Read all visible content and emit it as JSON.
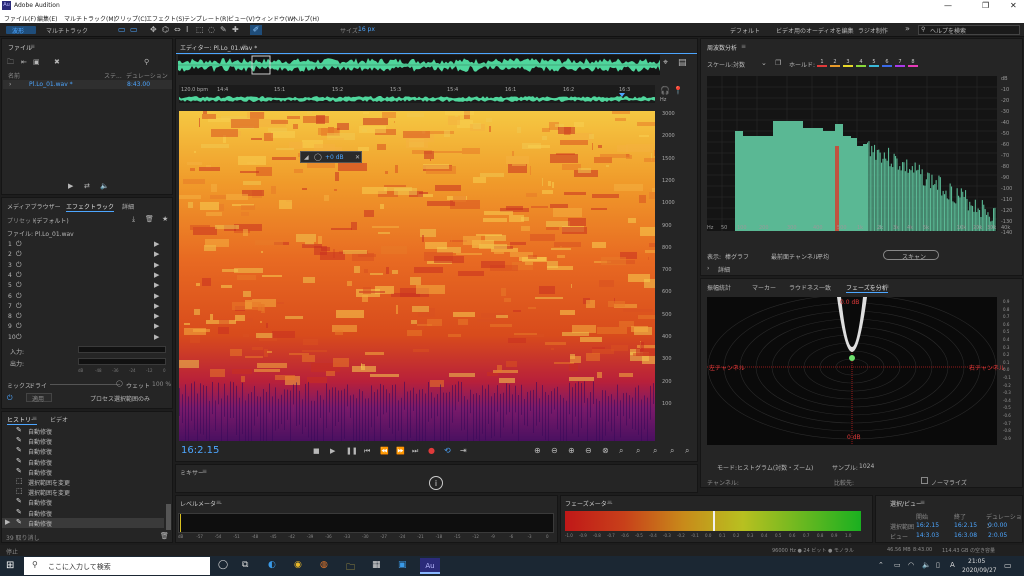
{
  "window": {
    "title": "Adobe Audition",
    "app_icon": "Au",
    "controls": [
      "—",
      "❐",
      "✕"
    ]
  },
  "menu": [
    "ファイル(F)",
    "編集(E)",
    "マルチトラック(M)",
    "クリップ(C)",
    "エフェクト(S)",
    "テンプレート(R)",
    "ビュー(V)",
    "ウィンドウ(W)",
    "ヘルプ(H)"
  ],
  "toolbar": {
    "mode_waveform": "波形",
    "mode_multitrack": "マルチトラック",
    "size_label": "サイズ:",
    "size_value": "16 px",
    "workspaces": [
      "デフォルト",
      "ビデオ用のオーディオを編集",
      "ラジオ制作"
    ],
    "help_search": "ヘルプを検索"
  },
  "files_panel": {
    "title": "ファイル",
    "col_name": "名前",
    "col_status": "ステ...",
    "col_duration": "デュレーション",
    "file_name": "Pl.Lo_01.wav *",
    "file_duration": "8:43.00"
  },
  "effects_panel": {
    "tabs": [
      "メディアブラウザー",
      "エフェクトラック",
      "詳細"
    ],
    "preset_label": "プリセット:",
    "preset_value": "(デフォルト)",
    "file_label": "ファイル: Pl.Lo_01.wav",
    "slots": [
      "1",
      "2",
      "3",
      "4",
      "5",
      "6",
      "7",
      "8",
      "9",
      "10"
    ],
    "input_label": "入力:",
    "output_label": "出力:",
    "db_scale": [
      "dB",
      "-48",
      "-36",
      "-24",
      "-12",
      "0"
    ],
    "mix_label": "ミックス:",
    "mix_dry": "ドライ",
    "mix_wet": "ウェット",
    "mix_value": "100 %",
    "apply_button": "適用",
    "process_label": "プロセス:",
    "process_value": "選択範囲のみ"
  },
  "history_panel": {
    "tabs": [
      "ヒストリー",
      "ビデオ"
    ],
    "items": [
      "自動修復",
      "自動修復",
      "自動修復",
      "自動修復",
      "自動修復",
      "選択範囲を変更",
      "選択範囲を変更",
      "自動修復",
      "自動修復",
      "自動修復"
    ],
    "undo_count": "39 取り消し"
  },
  "editor": {
    "title": "エディター: Pl.Lo_01.wav *",
    "timeline": [
      "120.0 bpm",
      "14:4",
      "15:1",
      "15:2",
      "15:3",
      "15:4",
      "16:1",
      "16:2",
      "16:3"
    ],
    "hud_value": "+0 dB",
    "freq_scale": [
      "Hz",
      "3000",
      "2000",
      "1500",
      "1200",
      "1000",
      "900",
      "800",
      "700",
      "600",
      "500",
      "400",
      "300",
      "200",
      "100"
    ],
    "time_display": "16:2.15",
    "mixer_tab": "ミキサー"
  },
  "freq_panel": {
    "title": "周波数分析",
    "scale_label": "スケール:",
    "scale_value": "対数",
    "hold_label": "ホールド:",
    "hold_colors": [
      "#e03a3a",
      "#e89a2a",
      "#e8d82a",
      "#8ad83a",
      "#3ab8d8",
      "#3a6ae8",
      "#a83ae8",
      "#e83ab8"
    ],
    "db_scale": [
      "dB",
      "-10",
      "-20",
      "-30",
      "-40",
      "-50",
      "-60",
      "-70",
      "-80",
      "-90",
      "-100",
      "-110",
      "-120",
      "-130",
      "-140"
    ],
    "hz_scale": [
      "Hz",
      "50",
      "100",
      "200",
      "300",
      "400",
      "500",
      "1k",
      "2k",
      "3k",
      "4k",
      "5k",
      "10k",
      "20k",
      "30k",
      "40k"
    ],
    "view_label": "表示:",
    "view_value": "棒グラフ",
    "channel_label": "最前面チャンネル:",
    "channel_value": "平均",
    "scan_button": "スキャン",
    "detail_label": "詳細"
  },
  "phase_panel": {
    "tabs": [
      "振幅統計",
      "マーカー",
      "ラウドネス一致",
      "フェーズを分析"
    ],
    "left_label": "左チャンネル",
    "right_label": "右チャンネル",
    "center_label": "0 dB",
    "top_label": "0.0 dB",
    "mode_label": "モード:",
    "mode_value": "ヒストグラム(対数・ズーム)",
    "sample_label": "サンプル:",
    "sample_value": "1024",
    "channel_label": "チャンネル:",
    "compare_label": "比較先:",
    "normalize_label": "ノーマライズ",
    "y_scale": [
      "0.9",
      "0.8",
      "0.7",
      "0.6",
      "0.5",
      "0.4",
      "0.3",
      "0.2",
      "0.1",
      "0.0",
      "-0.1",
      "-0.2",
      "-0.3",
      "-0.4",
      "-0.5",
      "-0.6",
      "-0.7",
      "-0.8",
      "-0.9"
    ]
  },
  "level_meter": {
    "title": "レベルメーター",
    "scale": [
      "dB",
      "-57",
      "-54",
      "-51",
      "-48",
      "-45",
      "-42",
      "-39",
      "-36",
      "-33",
      "-30",
      "-27",
      "-24",
      "-21",
      "-18",
      "-15",
      "-12",
      "-9",
      "-6",
      "-3",
      "0"
    ]
  },
  "phase_meter": {
    "title": "フェーズメーター",
    "scale": [
      "-1.0",
      "-0.9",
      "-0.8",
      "-0.7",
      "-0.6",
      "-0.5",
      "-0.4",
      "-0.3",
      "-0.2",
      "-0.1",
      "0.0",
      "0.1",
      "0.2",
      "0.3",
      "0.4",
      "0.5",
      "0.6",
      "0.7",
      "0.8",
      "0.9",
      "1.0"
    ]
  },
  "selection_panel": {
    "title": "選択/ビュー",
    "col_start": "開始",
    "col_end": "終了",
    "col_duration": "デュレーション",
    "row_sel": "選択範囲",
    "sel_start": "16:2.15",
    "sel_end": "16:2.15",
    "sel_dur": "0:0.00",
    "row_view": "ビュー",
    "view_start": "14:3.03",
    "view_end": "16:3.08",
    "view_dur": "2:0.05"
  },
  "status": {
    "left": "停止",
    "sample": "96000 Hz ● 24 ビット ● モノラル",
    "size": "46.56 MB",
    "duration": "8:43.00",
    "free": "114.43 GB の空き容量"
  },
  "taskbar": {
    "search": "ここに入力して検索",
    "time": "21:05",
    "date": "2020/09/27",
    "lang": "A"
  }
}
